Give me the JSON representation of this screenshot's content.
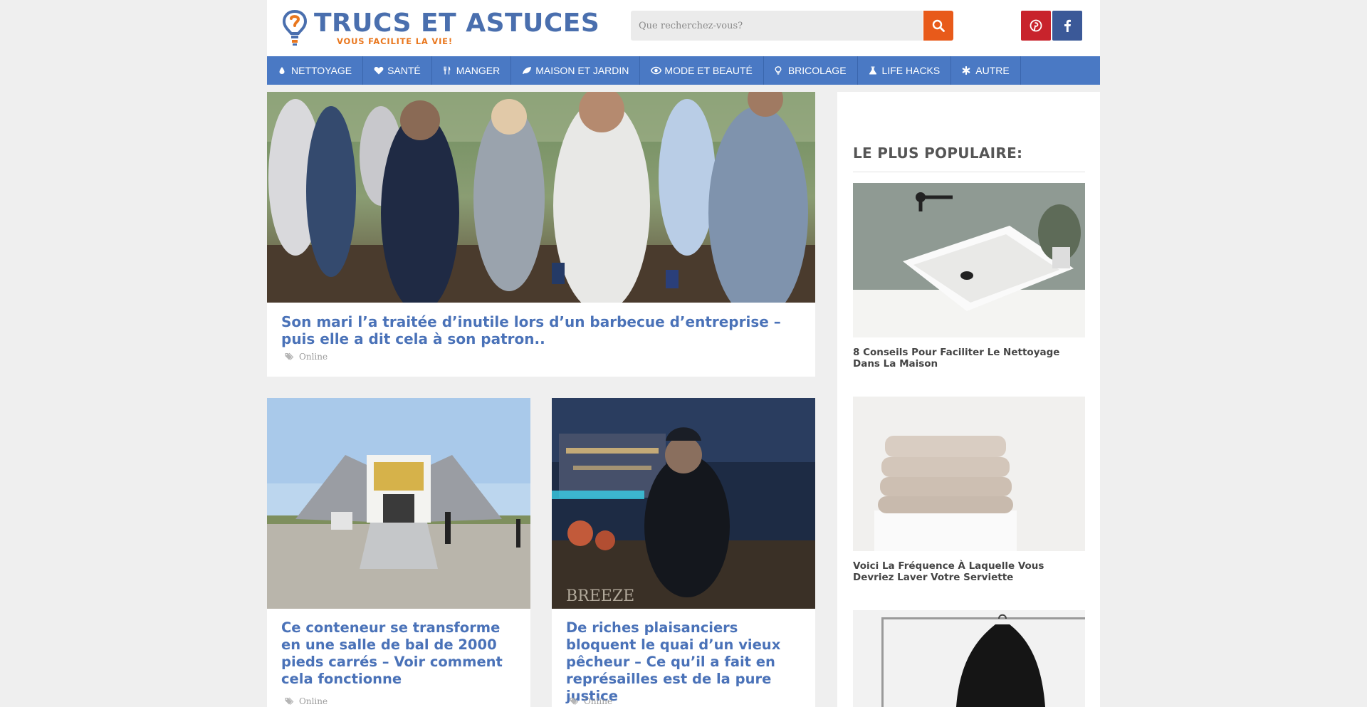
{
  "header": {
    "logo_title": "TRUCS ET ASTUCES",
    "logo_subtitle": "VOUS FACILITE LA VIE!",
    "search_placeholder": "Que recherchez-vous?"
  },
  "colors": {
    "brand_blue": "#4a79c4",
    "title_blue": "#4a72b8",
    "search_orange": "#e85a1a",
    "pinterest_red": "#c8232c",
    "facebook_blue": "#3b5998"
  },
  "social": [
    {
      "name": "pinterest",
      "icon": "pinterest-icon"
    },
    {
      "name": "facebook",
      "icon": "facebook-icon"
    }
  ],
  "nav": {
    "items": [
      {
        "label": "Nettoyage",
        "icon": "drop-icon"
      },
      {
        "label": "Santé",
        "icon": "heart-icon"
      },
      {
        "label": "Manger",
        "icon": "cutlery-icon"
      },
      {
        "label": "Maison et Jardin",
        "icon": "leaf-icon"
      },
      {
        "label": "Mode et Beauté",
        "icon": "eye-icon"
      },
      {
        "label": "Bricolage",
        "icon": "lightbulb-icon"
      },
      {
        "label": "Life Hacks",
        "icon": "flask-icon"
      },
      {
        "label": "Autre",
        "icon": "asterisk-icon"
      }
    ]
  },
  "articles": [
    {
      "title": "Son mari l’a traitée d’inutile lors d’un barbecue d’entreprise – puis elle a dit cela à son patron..",
      "tag": "Online",
      "image": "people-at-corporate-barbecue"
    },
    {
      "title": "Ce conteneur se transforme en une salle de bal de 2000 pieds carrés – Voir comment cela fonctionne",
      "tag": "Online",
      "image": "expanding-container-hall"
    },
    {
      "title": "De riches plaisanciers bloquent le quai d’un vieux pêcheur – Ce qu’il a fait en représailles est de la pure justice",
      "tag": "Online",
      "image": "old-fisherman-at-night-dock"
    }
  ],
  "sidebar": {
    "heading": "LE PLUS POPULAIRE:",
    "items": [
      {
        "title": "8 Conseils Pour Faciliter Le Nettoyage Dans La Maison",
        "image": "white-washbasin"
      },
      {
        "title": "Voici La Fréquence À Laquelle Vous Devriez Laver Votre Serviette",
        "image": "folded-towels"
      },
      {
        "title": "",
        "image": "black-jacket-on-rack"
      }
    ]
  }
}
